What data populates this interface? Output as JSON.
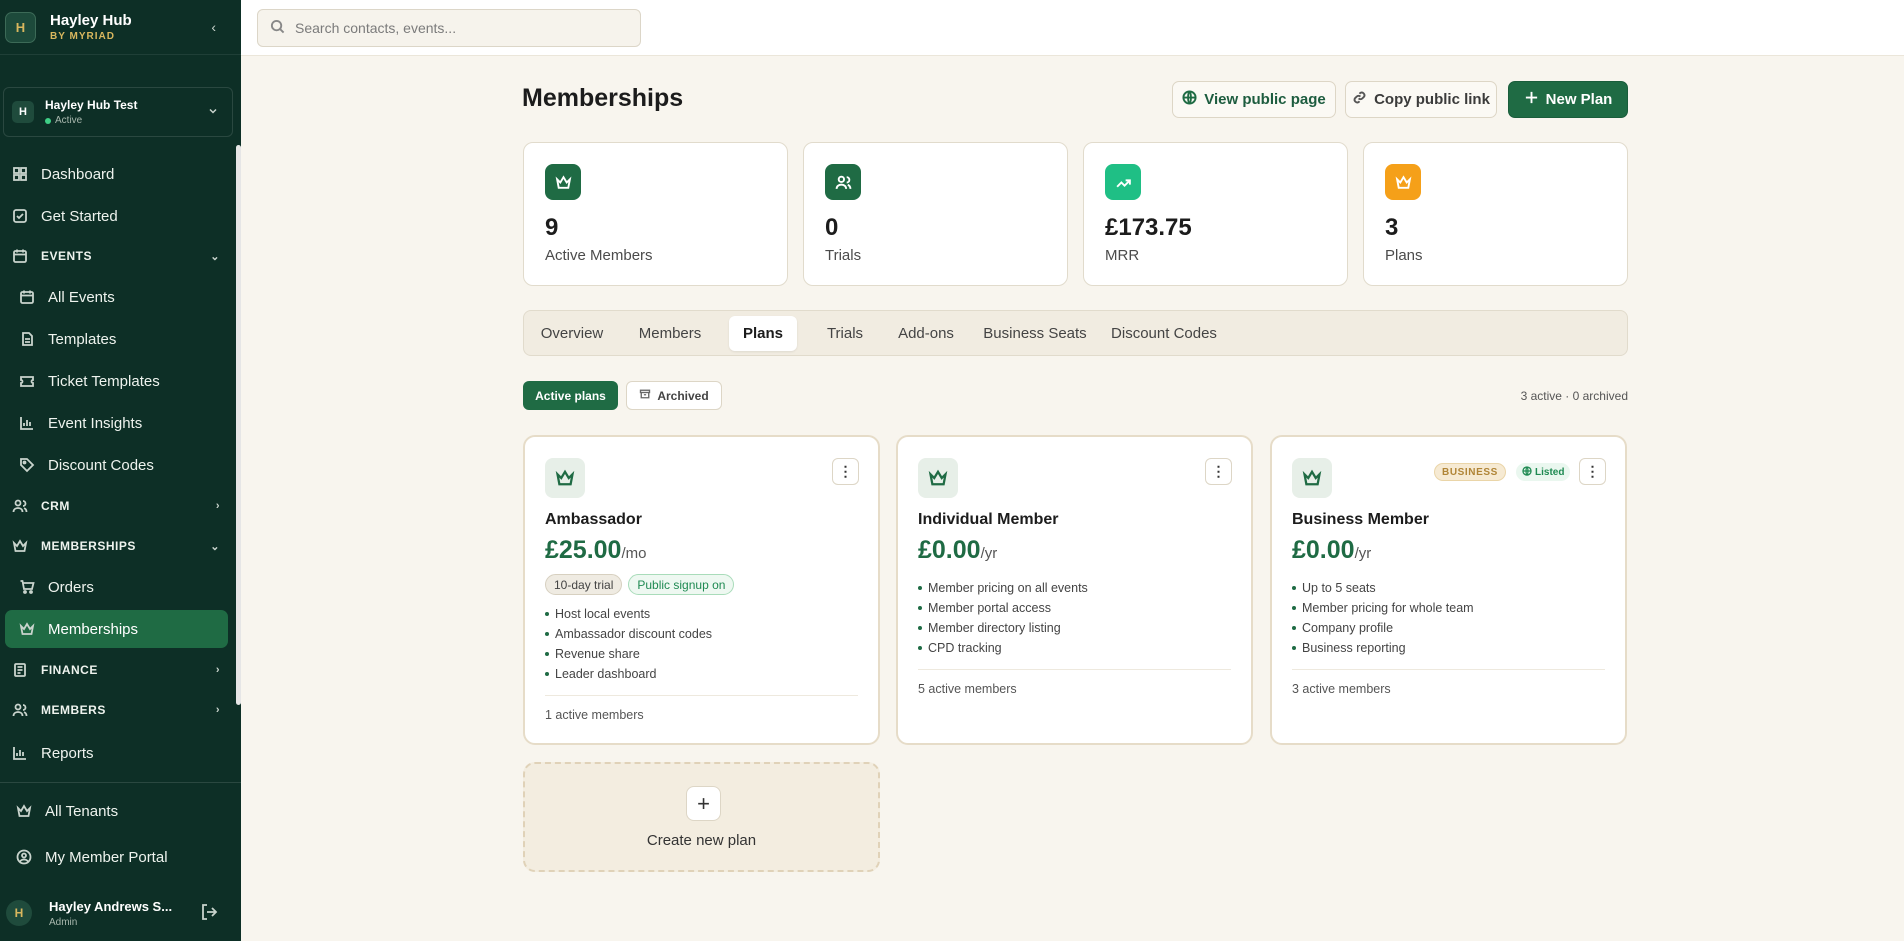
{
  "brand": {
    "name": "Hayley Hub",
    "sub": "BY MYRIAD",
    "logo": "H"
  },
  "tenant": {
    "initial": "H",
    "name": "Hayley Hub Test",
    "status": "Active"
  },
  "nav": {
    "dashboard": "Dashboard",
    "get_started": "Get Started",
    "events": "EVENTS",
    "all_events": "All Events",
    "templates": "Templates",
    "ticket_templates": "Ticket Templates",
    "event_insights": "Event Insights",
    "discount_codes": "Discount Codes",
    "crm": "CRM",
    "memberships": "MEMBERSHIPS",
    "orders": "Orders",
    "memberships_item": "Memberships",
    "finance": "FINANCE",
    "members": "MEMBERS",
    "reports": "Reports",
    "all_tenants": "All Tenants",
    "my_member_portal": "My Member Portal"
  },
  "user": {
    "initial": "H",
    "name": "Hayley Andrews S...",
    "role": "Admin"
  },
  "search": {
    "placeholder": "Search contacts, events..."
  },
  "page": {
    "title": "Memberships",
    "view_public": "View public page",
    "copy_link": "Copy public link",
    "new_plan": "New Plan"
  },
  "stats": [
    {
      "value": "9",
      "label": "Active Members",
      "color": "#1f6b44",
      "icon": "crown-icon"
    },
    {
      "value": "0",
      "label": "Trials",
      "color": "#1f6b44",
      "icon": "users-icon"
    },
    {
      "value": "£173.75",
      "label": "MRR",
      "color": "#1fbf85",
      "icon": "trending-up-icon"
    },
    {
      "value": "3",
      "label": "Plans",
      "color": "#f5a019",
      "icon": "crown-icon"
    }
  ],
  "tabs": [
    "Overview",
    "Members",
    "Plans",
    "Trials",
    "Add-ons",
    "Business Seats",
    "Discount Codes"
  ],
  "active_tab": "Plans",
  "filters": {
    "active": "Active plans",
    "archived": "Archived",
    "counts": "3 active · 0 archived"
  },
  "plans": [
    {
      "name": "Ambassador",
      "price": "£25.00",
      "period": "/mo",
      "pills": [
        "10-day trial",
        "Public signup on"
      ],
      "features": [
        "Host local events",
        "Ambassador discount codes",
        "Revenue share",
        "Leader dashboard"
      ],
      "footer": "1 active members"
    },
    {
      "name": "Individual Member",
      "price": "£0.00",
      "period": "/yr",
      "features": [
        "Member pricing on all events",
        "Member portal access",
        "Member directory listing",
        "CPD tracking"
      ],
      "footer": "5 active members"
    },
    {
      "name": "Business Member",
      "price": "£0.00",
      "period": "/yr",
      "badges": {
        "business": "BUSINESS",
        "listed": "Listed"
      },
      "features": [
        "Up to 5 seats",
        "Member pricing for whole team",
        "Company profile",
        "Business reporting"
      ],
      "footer": "3 active members"
    }
  ],
  "create": {
    "label": "Create new plan"
  },
  "colors": {
    "sidebar": "#0d2f26",
    "accent": "#1f6b44",
    "gold": "#d9b75e",
    "background": "#f8f5ee"
  }
}
